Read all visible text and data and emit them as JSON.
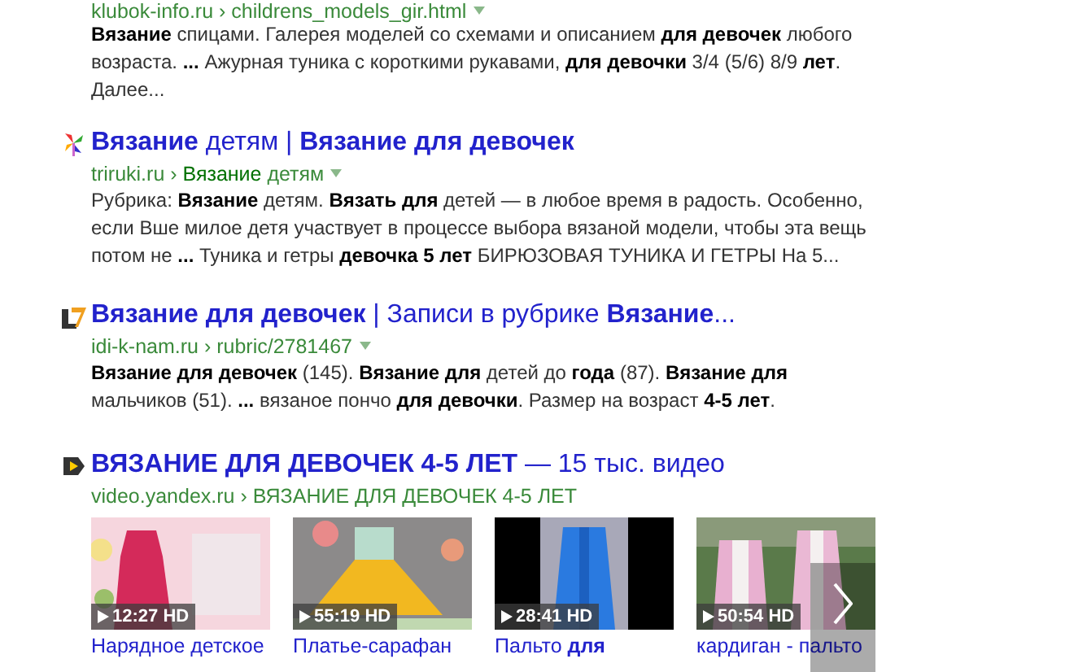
{
  "results": [
    {
      "kind": "web",
      "url": "klubok-info.ru › childrens_models_gir.html",
      "snippet": "**Вязание** спицами. Галерея моделей со схемами и описанием **для девочек** любого возраста. **...** Ажурная туника с короткими рукавами, **для девочки** 3/4 (5/6) 8/9 **лет**. Далее..."
    },
    {
      "kind": "web",
      "title": "**Вязание** детям | **Вязание для девочек**",
      "url": "triruki.ru › **Вязание** детям",
      "snippet": "Рубрика: **Вязание** детям. **Вязать для** детей — в любое время в радость. Особенно, если Вше милое детя участвует в процессе выбора вязаной модели, чтобы эта вещь потом не **...** Туника и гетры **девочка 5 лет** БИРЮЗОВАЯ ТУНИКА И ГЕТРЫ На 5..."
    },
    {
      "kind": "web",
      "title": "**Вязание для девочек** | Записи в рубрике **Вязание**...",
      "url": "idi-k-nam.ru › rubric/2781467",
      "snippet": "**Вязание для девочек** (145). **Вязание для** детей до **года** (87). **Вязание для** мальчиков (51). **...** вязаное пончо **для девочки**. Размер на возраст **4-5 лет**."
    },
    {
      "kind": "video",
      "title": "**ВЯЗАНИЕ ДЛЯ ДЕВОЧЕК 4-5 ЛЕТ** — 15 тыс. видео",
      "url": "video.yandex.ru › ВЯЗАНИЕ ДЛЯ ДЕВОЧЕК 4-5 ЛЕТ",
      "videos": [
        {
          "duration": "12:27 HD",
          "caption": "Нарядное детское"
        },
        {
          "duration": "55:19 HD",
          "caption": "Платье-сарафан"
        },
        {
          "duration": "28:41 HD",
          "caption": "Пальто **для**"
        },
        {
          "duration": "50:54 HD",
          "caption": "кардиган - пальто"
        }
      ]
    }
  ]
}
